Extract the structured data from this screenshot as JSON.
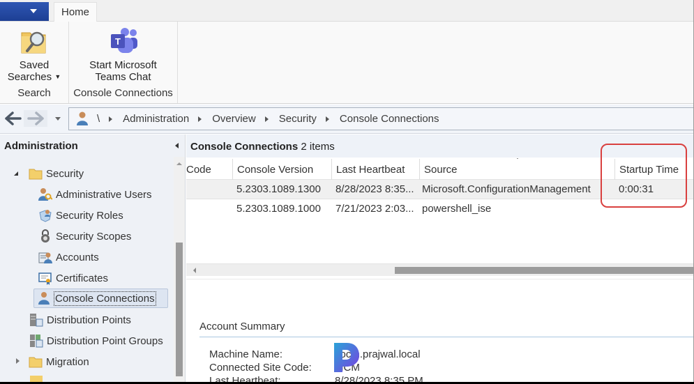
{
  "ribbon": {
    "tabs": [
      {
        "label": "Home",
        "active": true
      }
    ],
    "groups": [
      {
        "label": "Search",
        "buttons": [
          {
            "label_line1": "Saved",
            "label_line2": "Searches",
            "icon": "saved-searches-icon",
            "has_dropdown": true
          }
        ]
      },
      {
        "label": "Console Connections",
        "buttons": [
          {
            "label_line1": "Start Microsoft",
            "label_line2": "Teams Chat",
            "icon": "teams-icon"
          }
        ]
      }
    ]
  },
  "address_bar": {
    "root": "\\",
    "breadcrumbs": [
      "Administration",
      "Overview",
      "Security",
      "Console Connections"
    ]
  },
  "nav_pane": {
    "title": "Administration",
    "items": [
      {
        "label": "Security",
        "icon": "folder-icon",
        "expanded": true
      },
      {
        "label": "Administrative Users",
        "icon": "admin-users-icon"
      },
      {
        "label": "Security Roles",
        "icon": "security-roles-icon"
      },
      {
        "label": "Security Scopes",
        "icon": "lock-icon"
      },
      {
        "label": "Accounts",
        "icon": "accounts-icon"
      },
      {
        "label": "Certificates",
        "icon": "certificate-icon"
      },
      {
        "label": "Console Connections",
        "icon": "console-user-icon",
        "selected": true
      },
      {
        "label": "Distribution Points",
        "icon": "distribution-point-icon"
      },
      {
        "label": "Distribution Point Groups",
        "icon": "distribution-point-groups-icon"
      },
      {
        "label": "Migration",
        "icon": "folder-icon",
        "expanded": false
      }
    ]
  },
  "results": {
    "title": "Console Connections",
    "count_label": "2 items",
    "columns": [
      "Code",
      "Console Version",
      "Last Heartbeat",
      "Source",
      "Startup Time"
    ],
    "sorted_column": "Source",
    "rows": [
      {
        "code": "",
        "console_version": "5.2303.1089.1300",
        "last_heartbeat": "8/28/2023 8:35...",
        "source": "Microsoft.ConfigurationManagement",
        "startup_time": "0:00:31",
        "selected": true
      },
      {
        "code": "",
        "console_version": "5.2303.1089.1000",
        "last_heartbeat": "7/21/2023 2:03...",
        "source": "powershell_ise",
        "startup_time": ""
      }
    ]
  },
  "details": {
    "section_title": "Account Summary",
    "fields": [
      {
        "label": "Machine Name:",
        "value": "cocm.prajwal.local"
      },
      {
        "label": "Connected Site Code:",
        "value": "MCM"
      },
      {
        "label": "Last Heartbeat:",
        "value": "8/28/2023 8:35 PM"
      }
    ]
  },
  "annotation": {
    "highlight_color": "#d9403f",
    "target": "Startup Time"
  }
}
